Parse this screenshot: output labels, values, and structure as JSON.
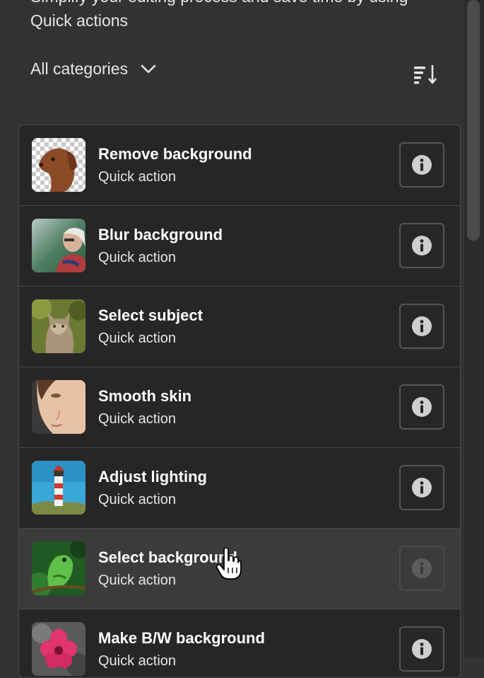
{
  "header": {
    "description_partial": "Simplify your editing process and save time by using",
    "description_last": "Quick actions",
    "category_label": "All categories"
  },
  "items": [
    {
      "title": "Remove background",
      "subtitle": "Quick action"
    },
    {
      "title": "Blur background",
      "subtitle": "Quick action"
    },
    {
      "title": "Select subject",
      "subtitle": "Quick action"
    },
    {
      "title": "Smooth skin",
      "subtitle": "Quick action"
    },
    {
      "title": "Adjust lighting",
      "subtitle": "Quick action"
    },
    {
      "title": "Select background",
      "subtitle": "Quick action"
    },
    {
      "title": "Make B/W background",
      "subtitle": "Quick action"
    }
  ],
  "icons": {
    "category_dropdown": "chevron-down-icon",
    "sort": "sort-icon",
    "info": "info-icon",
    "cursor": "hand-pointer-icon"
  },
  "colors": {
    "panel_bg": "#323232",
    "list_bg": "#262626",
    "hover_row": "#3b3b3b",
    "border": "#4a4a4a"
  },
  "state": {
    "hovered_item_index": 5
  }
}
